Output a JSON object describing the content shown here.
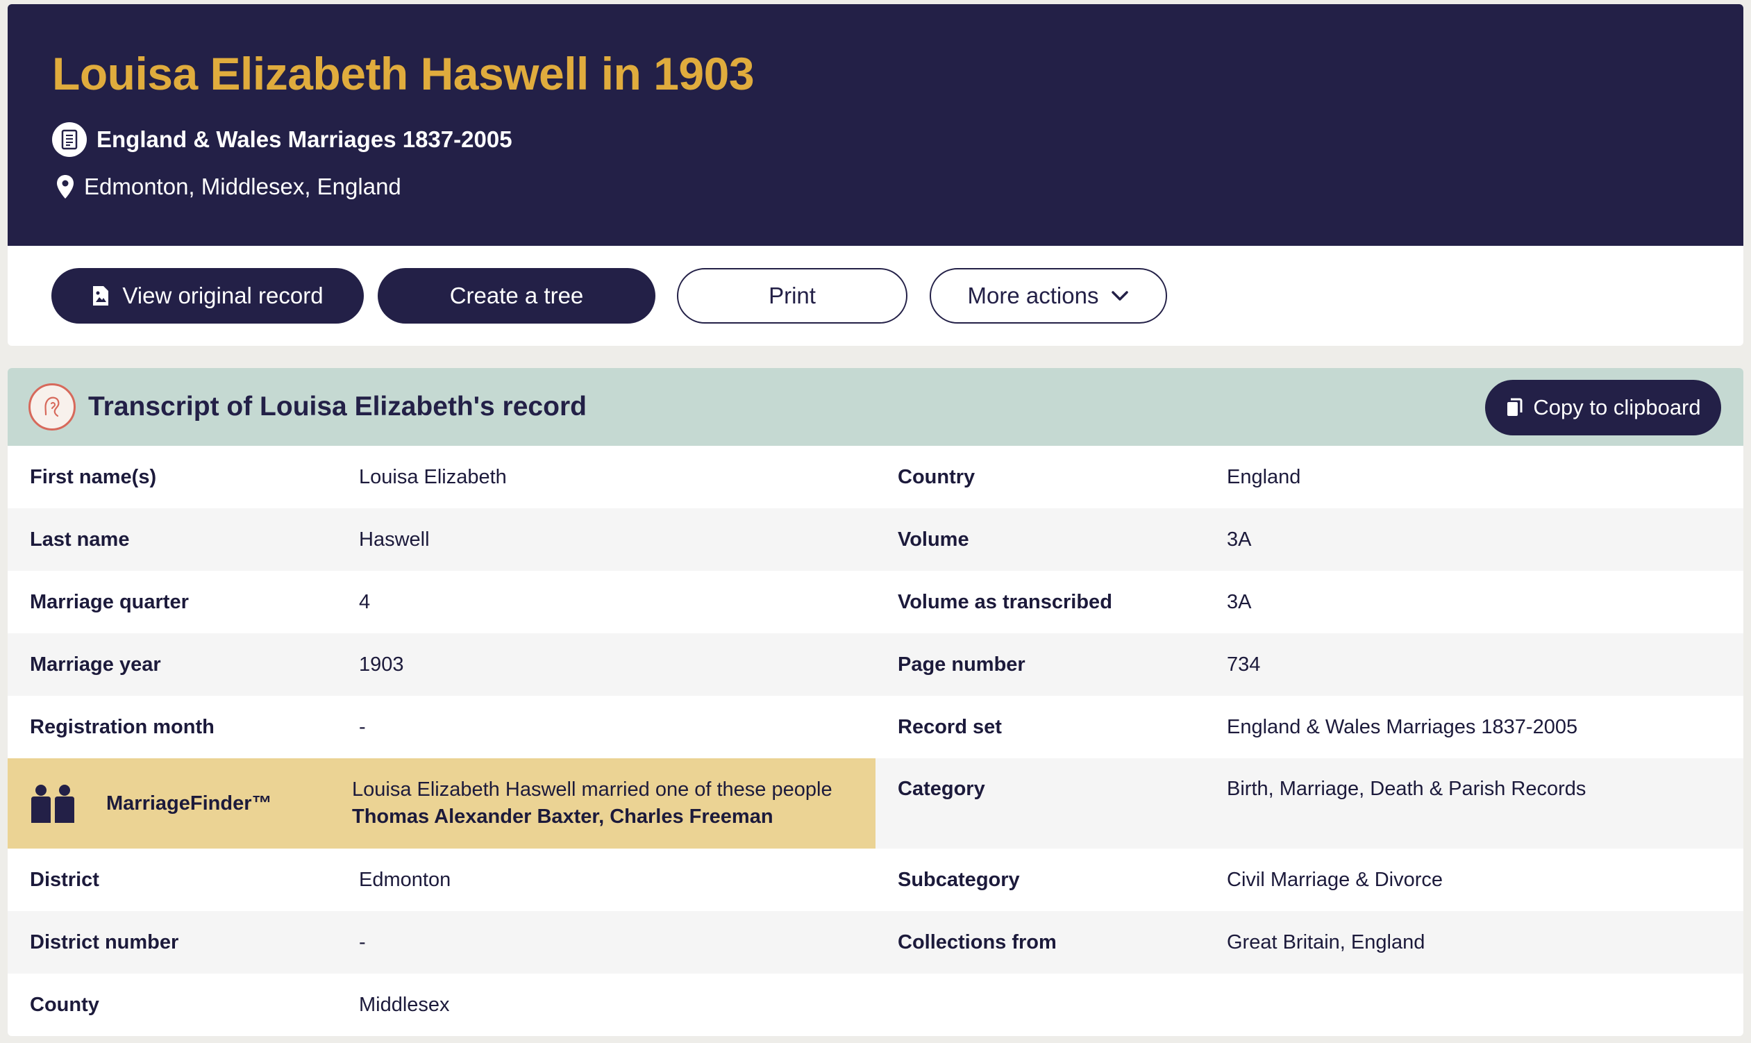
{
  "header": {
    "title": "Louisa Elizabeth Haswell in 1903",
    "record_set": "England & Wales Marriages 1837-2005",
    "location": "Edmonton, Middlesex, England"
  },
  "actions": {
    "view_original": "View original record",
    "create_tree": "Create a tree",
    "print": "Print",
    "more_actions": "More actions"
  },
  "transcript": {
    "title": "Transcript of Louisa Elizabeth's record",
    "copy_label": "Copy to clipboard",
    "rows": [
      {
        "l1": "First name(s)",
        "v1": "Louisa Elizabeth",
        "l2": "Country",
        "v2": "England"
      },
      {
        "l1": "Last name",
        "v1": "Haswell",
        "l2": "Volume",
        "v2": "3A"
      },
      {
        "l1": "Marriage quarter",
        "v1": "4",
        "l2": "Volume as transcribed",
        "v2": "3A"
      },
      {
        "l1": "Marriage year",
        "v1": "1903",
        "l2": "Page number",
        "v2": "734"
      },
      {
        "l1": "Registration month",
        "v1": "-",
        "l2": "Record set",
        "v2": "England & Wales Marriages 1837-2005"
      },
      {
        "l2": "Category",
        "v2": "Birth, Marriage, Death & Parish Records"
      },
      {
        "l1": "District",
        "v1": "Edmonton",
        "l2": "Subcategory",
        "v2": "Civil Marriage & Divorce"
      },
      {
        "l1": "District number",
        "v1": "-",
        "l2": "Collections from",
        "v2": "Great Britain, England"
      },
      {
        "l1": "County",
        "v1": "Middlesex",
        "l2": "",
        "v2": ""
      }
    ],
    "marriage_finder": {
      "label": "MarriageFinder™",
      "text": "Louisa Elizabeth Haswell married one of these people",
      "names": "Thomas Alexander Baxter, Charles Freeman"
    }
  },
  "colors": {
    "header_bg": "#232047",
    "title": "#e0ac3d",
    "transcript_head": "#c5d9d2",
    "marriage_finder_bg": "#ebd394"
  }
}
